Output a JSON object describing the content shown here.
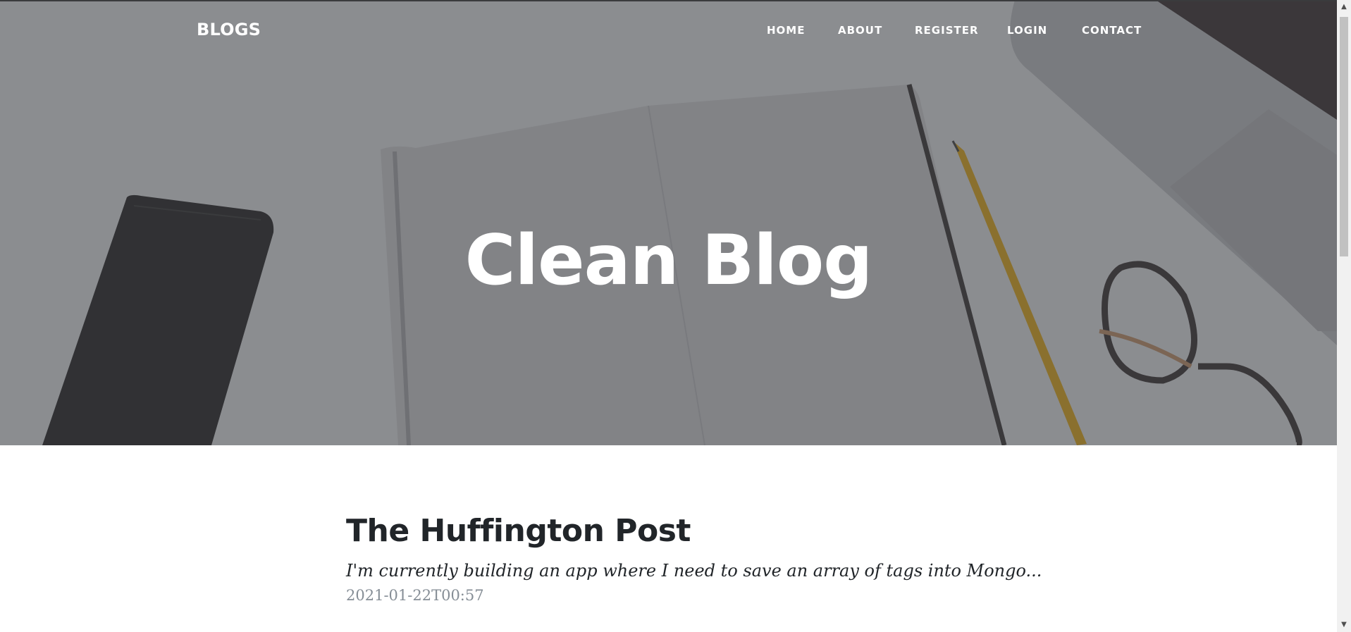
{
  "navbar": {
    "brand": "BLOGS",
    "links": [
      {
        "label": "HOME"
      },
      {
        "label": "ABOUT"
      },
      {
        "label": "REGISTER"
      },
      {
        "label": "LOGIN"
      },
      {
        "label": "CONTACT"
      }
    ]
  },
  "hero": {
    "title": "Clean Blog"
  },
  "posts": [
    {
      "title": "The Huffington Post",
      "excerpt": "I'm currently building an app where I need to save an array of tags into Mongo...",
      "date": "2021-01-22T00:57"
    }
  ],
  "colors": {
    "overlay": "#3c3e42",
    "post_title": "#212529",
    "post_meta": "#868e96"
  }
}
